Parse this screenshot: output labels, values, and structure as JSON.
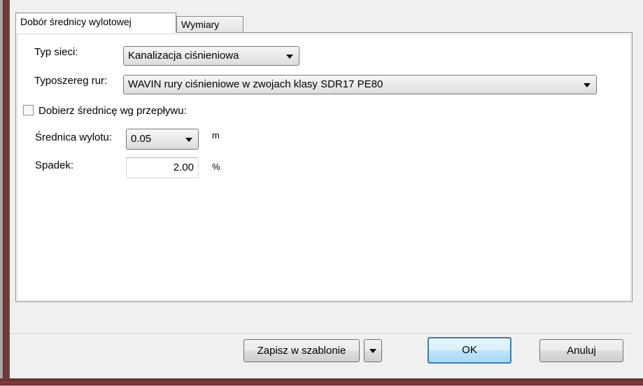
{
  "tabs": [
    {
      "label": "Dobór średnicy wylotowej",
      "active": true
    },
    {
      "label": "Wymiary",
      "active": false
    }
  ],
  "form": {
    "network_type_label": "Typ sieci:",
    "network_type_value": "Kanalizacja ciśnieniowa",
    "pipe_series_label": "Typoszereg rur:",
    "pipe_series_value": "WAVIN rury ciśnieniowe w zwojach klasy SDR17 PE80",
    "auto_diameter_label": "Dobierz średnicę wg przepływu:",
    "auto_diameter_checked": false,
    "outlet_diameter_label": "Średnica wylotu:",
    "outlet_diameter_value": "0.05",
    "outlet_diameter_unit": "m",
    "slope_label": "Spadek:",
    "slope_value": "2.00",
    "slope_unit": "%"
  },
  "buttons": {
    "save_template": "Zapisz w szablonie",
    "ok": "OK",
    "cancel": "Anuluj"
  },
  "icons": {
    "dropdown": "chevron-down-icon",
    "checkbox": "checkbox-unchecked-icon"
  },
  "colors": {
    "window_border": "#6e2a2a",
    "default_button_border": "#3c7fb1"
  }
}
